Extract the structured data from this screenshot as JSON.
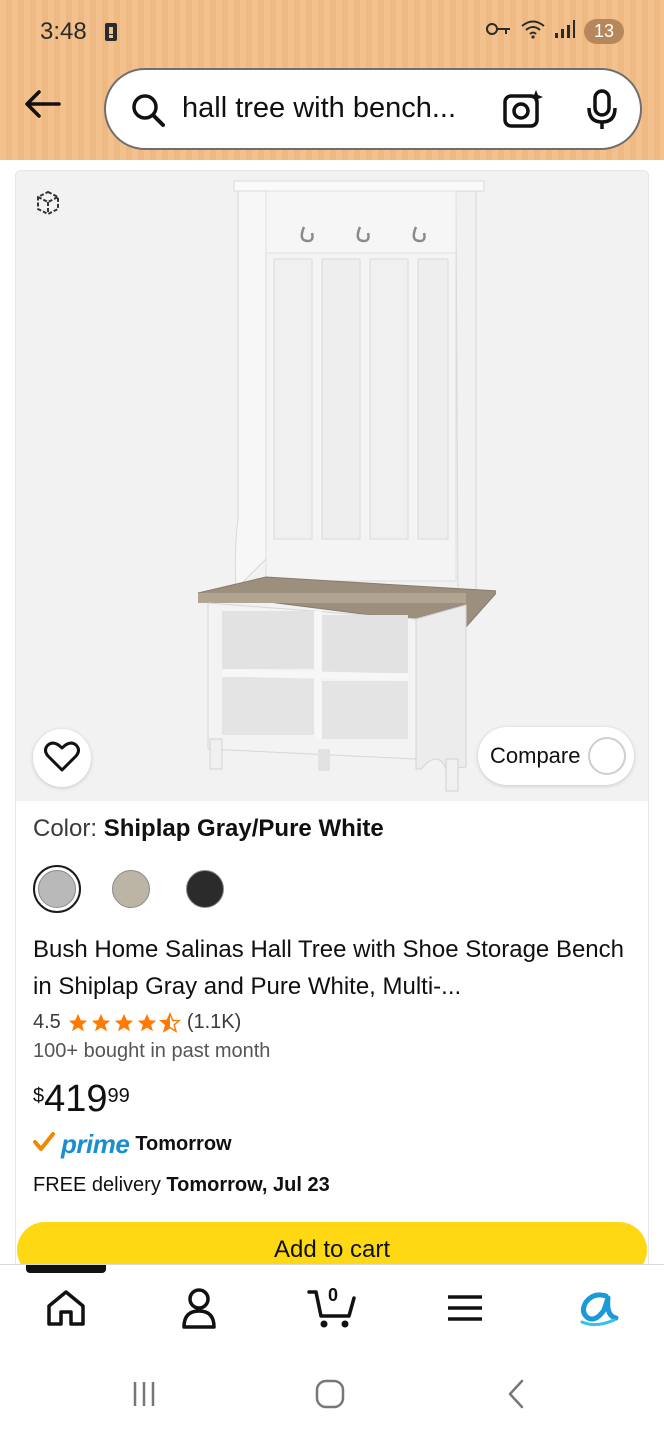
{
  "status_bar": {
    "time": "3:48",
    "notification_count": "13"
  },
  "search": {
    "query": "hall tree with bench..."
  },
  "product": {
    "color_label": "Color:",
    "color_value": "Shiplap Gray/Pure White",
    "swatches": [
      {
        "name": "Shiplap Gray/Pure White",
        "color": "#b9b9b9",
        "selected": true
      },
      {
        "name": "Shiplap Gray",
        "color": "#bcb5a6",
        "selected": false
      },
      {
        "name": "Black",
        "color": "#2b2b2b",
        "selected": false
      }
    ],
    "title": "Bush Home Salinas Hall Tree with Shoe Storage Bench in Shiplap Gray and Pure White, Multi-...",
    "rating": "4.5",
    "rating_value": 4.5,
    "review_count": "(1.1K)",
    "bought": "100+ bought in past month",
    "price_currency": "$",
    "price_whole": "419",
    "price_fraction": "99",
    "prime_label": "prime",
    "prime_delivery": "Tomorrow",
    "delivery_prefix": "FREE delivery ",
    "delivery_date": "Tomorrow, Jul 23",
    "compare_label": "Compare",
    "add_to_cart_label": "Add to cart"
  },
  "bottom_nav": {
    "cart_count": "0"
  },
  "colors": {
    "header_bg": "#f3c18d",
    "cart_button": "#ffd814",
    "prime_blue": "#1a8ed1",
    "star_orange": "#ff7a00"
  }
}
